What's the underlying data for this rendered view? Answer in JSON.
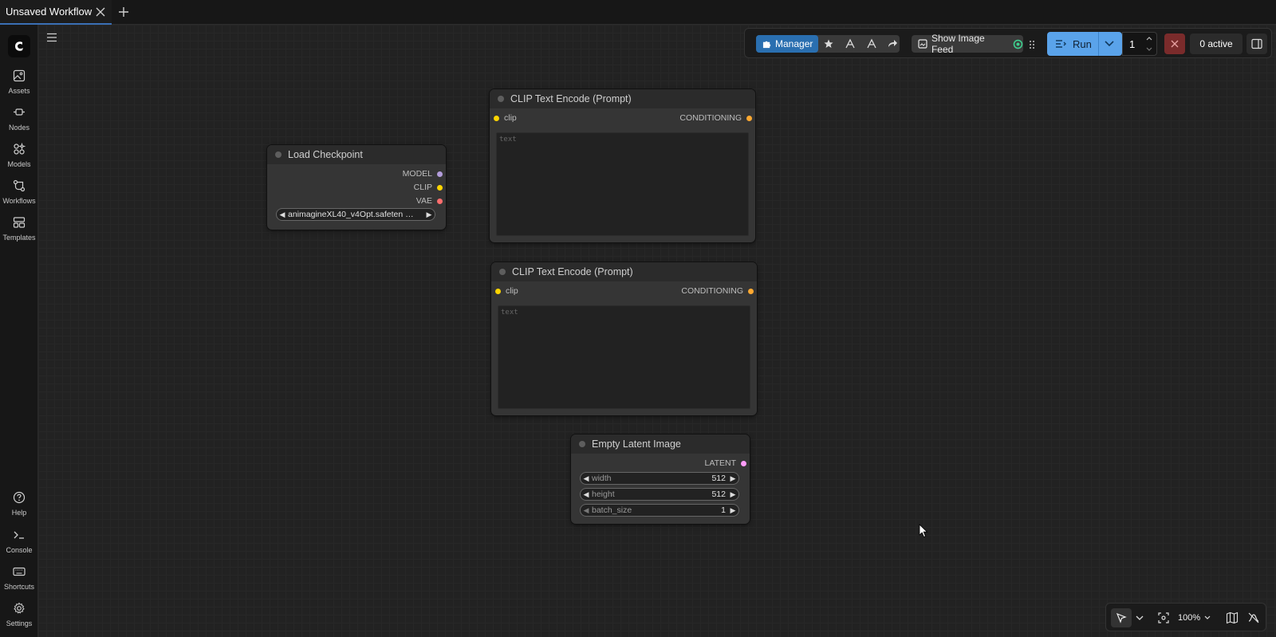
{
  "tabs": [
    {
      "label": "Unsaved Workflow",
      "active": true
    }
  ],
  "sidebar": {
    "items": [
      {
        "label": "Assets",
        "icon": "image-icon"
      },
      {
        "label": "Nodes",
        "icon": "node-icon"
      },
      {
        "label": "Models",
        "icon": "models-icon"
      },
      {
        "label": "Workflows",
        "icon": "workflow-icon"
      },
      {
        "label": "Templates",
        "icon": "templates-icon"
      }
    ],
    "bottom_items": [
      {
        "label": "Help",
        "icon": "help-icon"
      },
      {
        "label": "Console",
        "icon": "console-icon"
      },
      {
        "label": "Shortcuts",
        "icon": "keyboard-icon"
      },
      {
        "label": "Settings",
        "icon": "gear-icon"
      }
    ]
  },
  "toolbar": {
    "manager_label": "Manager",
    "feed_label": "Show Image Feed",
    "run_label": "Run",
    "batch_count": "1",
    "active_label": "0 active"
  },
  "nodes": {
    "load_checkpoint": {
      "title": "Load Checkpoint",
      "outputs": [
        "MODEL",
        "CLIP",
        "VAE"
      ],
      "ckpt_name": "animagineXL40_v4Opt.safeten …"
    },
    "clip_encode_1": {
      "title": "CLIP Text Encode (Prompt)",
      "input": "clip",
      "output": "CONDITIONING",
      "placeholder": "text"
    },
    "clip_encode_2": {
      "title": "CLIP Text Encode (Prompt)",
      "input": "clip",
      "output": "CONDITIONING",
      "placeholder": "text"
    },
    "empty_latent": {
      "title": "Empty Latent Image",
      "output": "LATENT",
      "widgets": [
        {
          "name": "width",
          "value": "512"
        },
        {
          "name": "height",
          "value": "512"
        },
        {
          "name": "batch_size",
          "value": "1"
        }
      ]
    }
  },
  "bottom_bar": {
    "zoom": "100%"
  },
  "colors": {
    "accent": "#2a6fb0",
    "run": "#5aa3ea",
    "stop": "#7a2b2b",
    "model_slot": "#b39ddb",
    "clip_slot": "#ffd500",
    "vae_slot": "#ff6e6e",
    "conditioning_slot": "#ffa931",
    "latent_slot": "#ff9cf9"
  }
}
